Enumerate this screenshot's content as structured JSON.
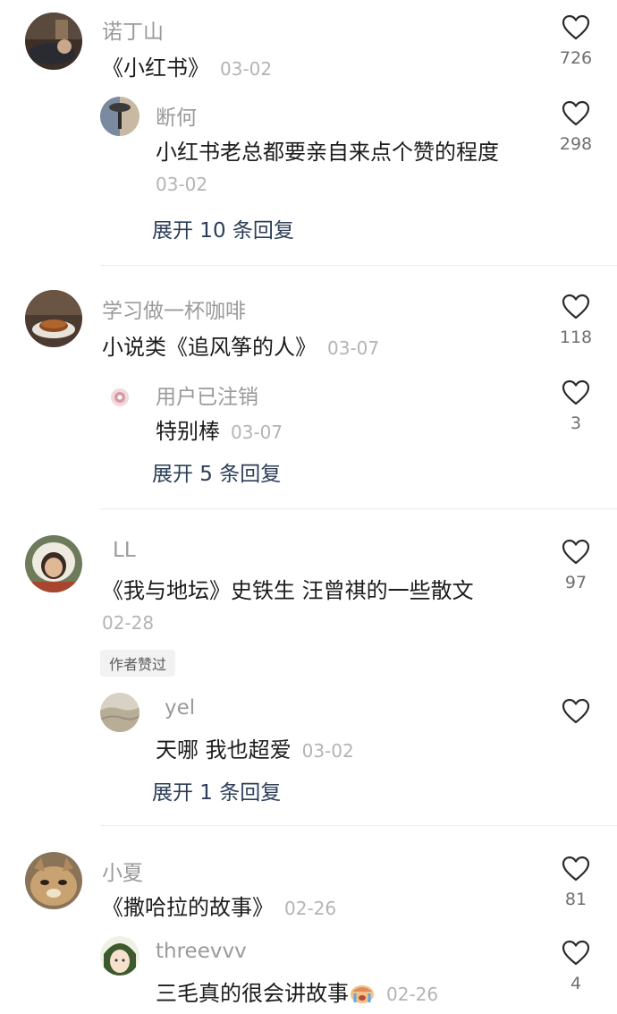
{
  "threads": [
    {
      "main": {
        "name": "诺丁山",
        "text": "《小红书》",
        "date": "03-02",
        "likes": "726"
      },
      "reply": {
        "name": "断何",
        "text": "小红书老总都要亲自来点个赞的程度",
        "date": "03-02",
        "likes": "298"
      },
      "expand": "展开 10 条回复"
    },
    {
      "main": {
        "name": "学习做一杯咖啡",
        "text": "小说类《追风筝的人》",
        "date": "03-07",
        "likes": "118"
      },
      "reply": {
        "name": "用户已注销",
        "text": "特别棒",
        "date": "03-07",
        "likes": "3"
      },
      "expand": "展开 5 条回复"
    },
    {
      "main": {
        "name": "LL",
        "text": "《我与地坛》史铁生 汪曾祺的一些散文",
        "date": "02-28",
        "likes": "97",
        "badge": "作者赞过"
      },
      "reply": {
        "name": "yel",
        "text": "天哪 我也超爱",
        "date": "03-02",
        "likes": ""
      },
      "expand": "展开 1 条回复"
    },
    {
      "main": {
        "name": "小夏",
        "text": "《撒哈拉的故事》",
        "date": "02-26",
        "likes": "81"
      },
      "reply": {
        "name": "threevvv",
        "text": "三毛真的很会讲故事",
        "date": "02-26",
        "likes": "4"
      }
    }
  ],
  "icons": {
    "like": "heart-outline-icon",
    "emoji": "crying-face-emoji"
  },
  "colors": {
    "expand": "#2c3e58",
    "meta": "#b4b4b4",
    "name": "#9a9a9a"
  }
}
